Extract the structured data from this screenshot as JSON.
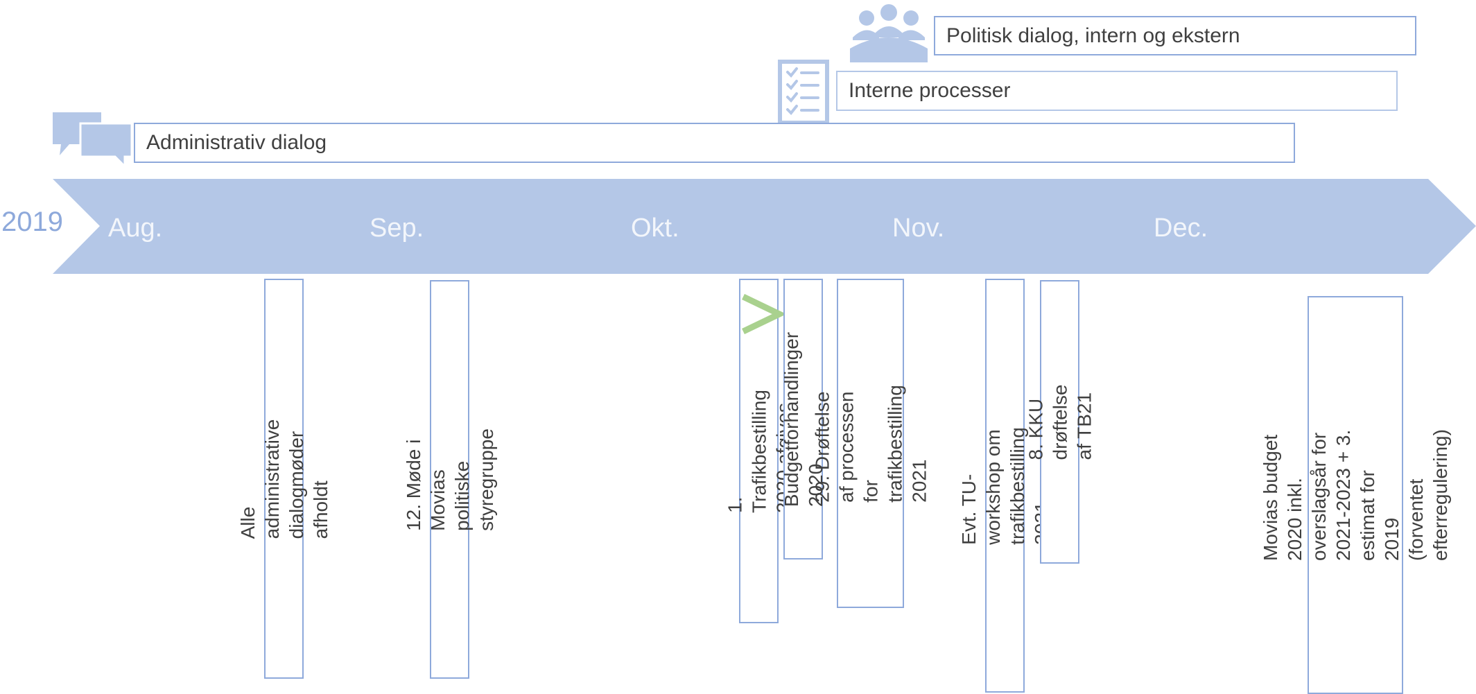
{
  "year": "2019",
  "months": [
    "Aug.",
    "Sep.",
    "Okt.",
    "Nov.",
    "Dec."
  ],
  "phases": {
    "political": "Politisk dialog, intern og ekstern",
    "internal": "Interne processer",
    "administrative": "Administrativ dialog"
  },
  "events": [
    {
      "label": "Alle administrative dialogmøder afholdt"
    },
    {
      "label": "12. Møde i Movias politiske styregruppe"
    },
    {
      "label": "1. Trafikbestilling 2020 afgives"
    },
    {
      "label": "Budgetforhandlinger 2020"
    },
    {
      "label": "29. Drøftelse af processen for\ntrafikbestilling 2021"
    },
    {
      "label": "Evt. TU-workshop om trafikbestilling 2021"
    },
    {
      "label": "8. KKU drøftelse af TB21"
    },
    {
      "label": "Movias budget 2020 inkl. overslagsår for\n2021-2023 + 3. estimat for 2019\n(forventet efterregulering)"
    }
  ],
  "colors": {
    "arrow": "#B4C7E7",
    "border": "#8EA9DB",
    "icon": "#B4C7E7",
    "chevron": "#A9D18E"
  }
}
